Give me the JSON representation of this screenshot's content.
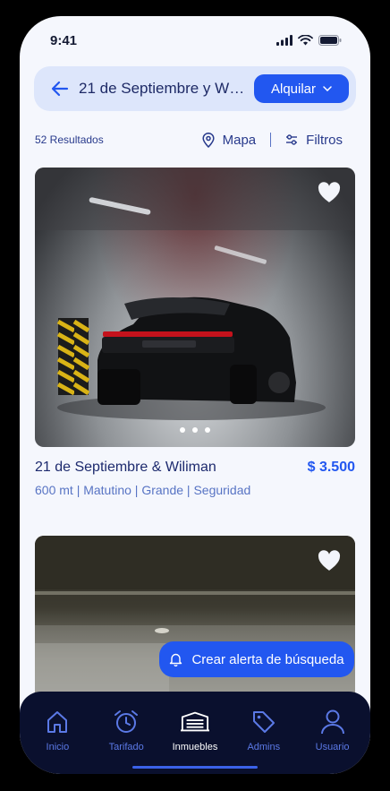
{
  "status_bar": {
    "time": "9:41"
  },
  "search": {
    "location": "21 de Septiembre y Wiliman",
    "mode": "Alquilar"
  },
  "results": {
    "count_label": "52 Resultados",
    "map_label": "Mapa",
    "filters_label": "Filtros"
  },
  "listings": [
    {
      "title": "21 de Septiembre & Wiliman",
      "price": "$ 3.500",
      "details": "600 mt | Matutino | Grande | Seguridad"
    }
  ],
  "alert_button": {
    "label": "Crear alerta de búsqueda"
  },
  "nav": [
    {
      "label": "Inicio",
      "icon": "home-icon"
    },
    {
      "label": "Tarifado",
      "icon": "alarm-clock-icon"
    },
    {
      "label": "Inmuebles",
      "icon": "garage-icon",
      "active": true
    },
    {
      "label": "Admins",
      "icon": "tag-icon"
    },
    {
      "label": "Usuario",
      "icon": "user-icon"
    }
  ],
  "colors": {
    "accent": "#2257f0",
    "nav_bg": "#0a102e",
    "page_bg": "#f5f7fd"
  }
}
